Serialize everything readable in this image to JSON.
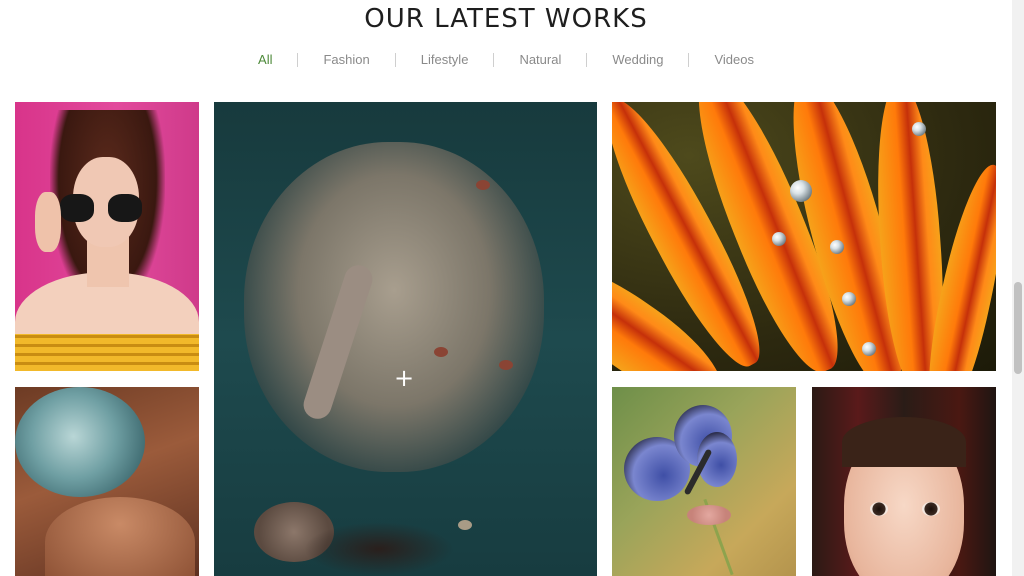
{
  "section": {
    "title": "OUR LATEST WORKS"
  },
  "filters": {
    "active": "All",
    "items": [
      {
        "label": "All"
      },
      {
        "label": "Fashion"
      },
      {
        "label": "Lifestyle"
      },
      {
        "label": "Natural"
      },
      {
        "label": "Wedding"
      },
      {
        "label": "Videos"
      }
    ]
  },
  "gallery": {
    "hover_overlay_icon": "plus-icon",
    "items": [
      {
        "subject": "woman-sunglasses"
      },
      {
        "subject": "fabric-rose"
      },
      {
        "subject": "underwater-dress"
      },
      {
        "subject": "orange-flower-droplets"
      },
      {
        "subject": "blue-butterfly"
      },
      {
        "subject": "child-portrait"
      }
    ]
  },
  "colors": {
    "accent": "#4e8a3a",
    "filter_text": "#8a8a8a",
    "title_text": "#1e1e1e"
  }
}
